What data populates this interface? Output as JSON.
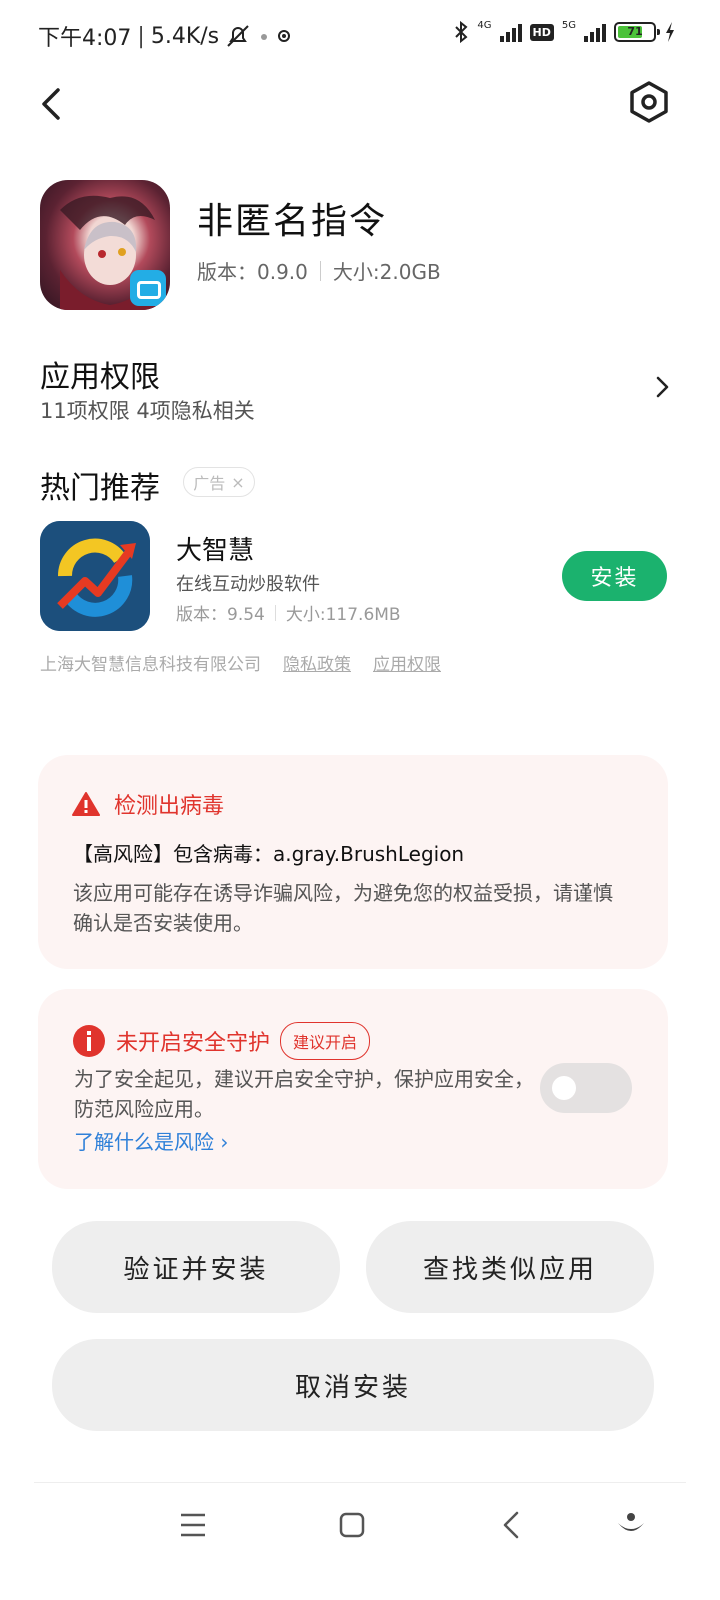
{
  "status_bar": {
    "time": "下午4:07",
    "separator": "|",
    "net_speed": "5.4K/s",
    "signal_1_label": "4G",
    "hd_label": "HD",
    "signal_2_label": "5G",
    "battery_level": "71",
    "battery_fill_percent": 71
  },
  "app": {
    "name": "非匿名指令",
    "version_label": "版本：",
    "version": "0.9.0",
    "size_label": "大小:",
    "size": "2.0GB"
  },
  "permissions": {
    "title": "应用权限",
    "subtitle": "11项权限 4项隐私相关"
  },
  "recommend": {
    "title": "热门推荐",
    "ad_label": "广告",
    "ad_close": "×",
    "app_name": "大智慧",
    "app_desc": "在线互动炒股软件",
    "version_label": "版本：",
    "version": "9.54",
    "size_label": "大小:",
    "size": "117.6MB",
    "install_label": "安装",
    "company": "上海大智慧信息科技有限公司",
    "privacy_link": "隐私政策",
    "permission_link": "应用权限"
  },
  "virus_warning": {
    "title": "检测出病毒",
    "virus_line": "【高风险】包含病毒：a.gray.BrushLegion",
    "description": "该应用可能存在诱导诈骗风险，为避免您的权益受损，请谨慎确认是否安装使用。"
  },
  "protection": {
    "title": "未开启安全守护",
    "suggest_tag": "建议开启",
    "description": "为了安全起见，建议开启安全守护，保护应用安全，防范风险应用。",
    "learn_link": "了解什么是风险 ›",
    "toggle_on": false
  },
  "actions": {
    "verify_install": "验证并安装",
    "find_similar": "查找类似应用",
    "cancel_install": "取消安装"
  },
  "colors": {
    "danger": "#e0342d",
    "install_green": "#1bb26e",
    "link_blue": "#2f80d8",
    "card_bg": "#fdf4f3"
  },
  "icons": {
    "back": "back-arrow-icon",
    "settings": "settings-hexagon-icon",
    "warning": "warning-triangle-icon",
    "info": "info-circle-icon",
    "nav_menu": "menu-icon",
    "nav_home": "home-square-icon",
    "nav_back": "back-triangle-icon",
    "nav_assistant": "assistant-icon"
  }
}
